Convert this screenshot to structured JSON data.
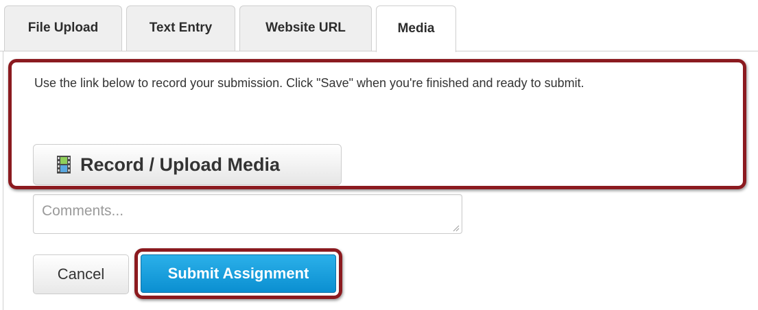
{
  "tabs": [
    {
      "label": "File Upload",
      "active": false
    },
    {
      "label": "Text Entry",
      "active": false
    },
    {
      "label": "Website URL",
      "active": false
    },
    {
      "label": "Media",
      "active": true
    }
  ],
  "media_panel": {
    "instructions": "Use the link below to record your submission. Click \"Save\" when you're finished and ready to submit.",
    "record_button_label": "Record / Upload Media",
    "record_button_icon": "film-icon"
  },
  "comments": {
    "placeholder": "Comments...",
    "value": ""
  },
  "actions": {
    "cancel_label": "Cancel",
    "submit_label": "Submit Assignment"
  },
  "colors": {
    "highlight_outline": "#8b1a1f",
    "submit_button": "#0b8fd1",
    "tab_inactive_bg": "#efefef"
  }
}
